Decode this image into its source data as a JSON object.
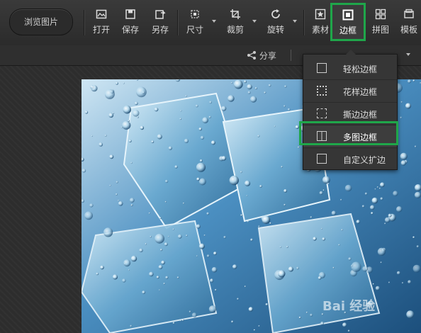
{
  "toolbar": {
    "browse_label": "浏览图片",
    "tools": [
      {
        "label": "打开",
        "icon": "image-open-icon"
      },
      {
        "label": "保存",
        "icon": "save-icon"
      },
      {
        "label": "另存",
        "icon": "save-as-icon"
      },
      {
        "label": "尺寸",
        "icon": "resize-icon"
      },
      {
        "label": "裁剪",
        "icon": "crop-icon"
      },
      {
        "label": "旋转",
        "icon": "rotate-icon"
      },
      {
        "label": "素材",
        "icon": "sticker-icon"
      },
      {
        "label": "边框",
        "icon": "frame-icon"
      },
      {
        "label": "拼图",
        "icon": "collage-icon"
      },
      {
        "label": "模板",
        "icon": "template-icon"
      }
    ]
  },
  "subbar": {
    "share_label": "分享"
  },
  "dropdown": {
    "items": [
      {
        "label": "轻松边框",
        "icon": "simple-frame-icon"
      },
      {
        "label": "花样边框",
        "icon": "fancy-frame-icon"
      },
      {
        "label": "撕边边框",
        "icon": "torn-frame-icon"
      },
      {
        "label": "多图边框",
        "icon": "multi-frame-icon"
      },
      {
        "label": "自定义扩边",
        "icon": "custom-expand-icon"
      }
    ],
    "highlighted_index": 3
  },
  "watermark": {
    "text": "Bai 经验"
  },
  "colors": {
    "highlight": "#1fa64a",
    "toolbar_bg": "#333333",
    "photo_water": "#3a7fb6"
  }
}
